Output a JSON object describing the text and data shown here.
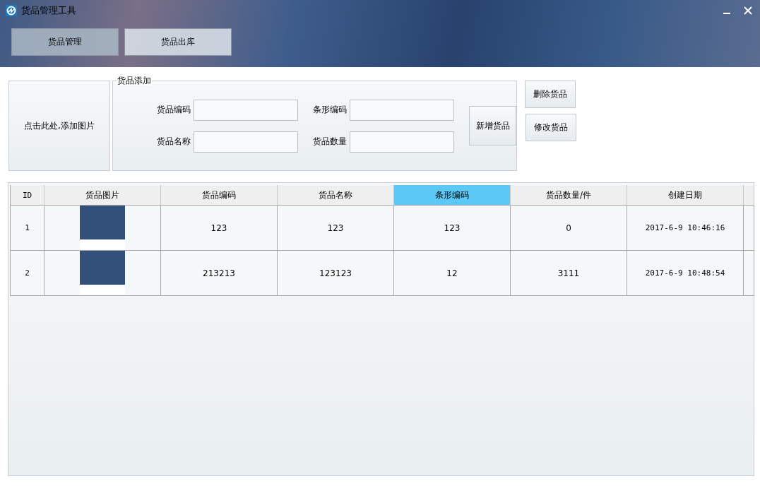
{
  "window": {
    "title": "货品管理工具"
  },
  "tabs": [
    {
      "label": "货品管理",
      "selected": true
    },
    {
      "label": "货品出库",
      "selected": false
    }
  ],
  "image_button": {
    "label": "点击此处,添加图片"
  },
  "add_group": {
    "title": "货品添加",
    "fields": [
      {
        "label": "货品编码"
      },
      {
        "label": "条形编码"
      },
      {
        "label": "货品名称"
      },
      {
        "label": "货品数量"
      }
    ],
    "submit": "新增货品"
  },
  "side_buttons": [
    "删除货品",
    "修改货品"
  ],
  "table": {
    "columns": [
      {
        "label": "ID",
        "highlighted": false
      },
      {
        "label": "货品图片",
        "highlighted": false
      },
      {
        "label": "货品编码",
        "highlighted": false
      },
      {
        "label": "货品名称",
        "highlighted": false
      },
      {
        "label": "条形编码",
        "highlighted": true
      },
      {
        "label": "货品数量/件",
        "highlighted": false
      },
      {
        "label": "创建日期",
        "highlighted": false
      }
    ],
    "rows": [
      {
        "id": "1",
        "code": "123",
        "name": "123",
        "barcode": "123",
        "quantity": "0",
        "created": "2017-6-9 10:46:16"
      },
      {
        "id": "2",
        "code": "213213",
        "name": "123123",
        "barcode": "12",
        "quantity": "3111",
        "created": "2017-6-9 10:48:54"
      }
    ]
  }
}
